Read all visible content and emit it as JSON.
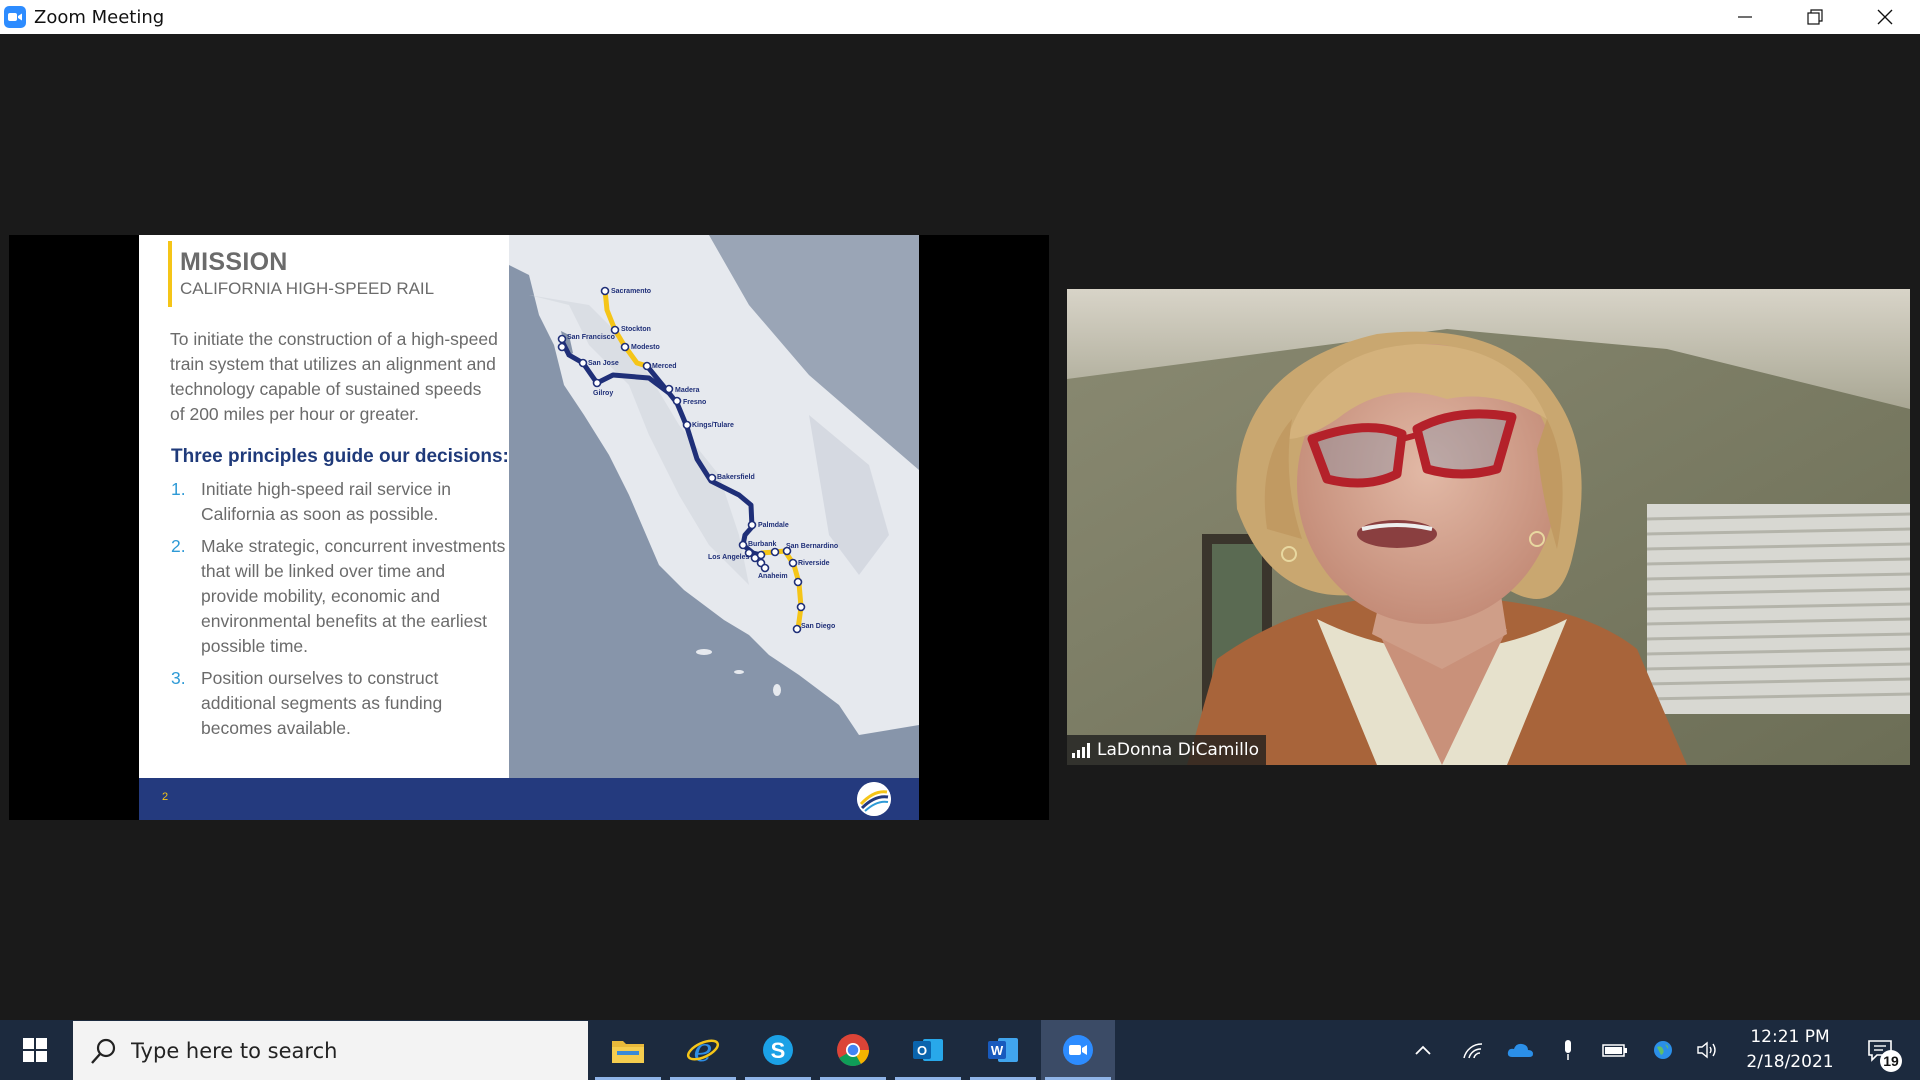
{
  "window": {
    "title": "Zoom Meeting"
  },
  "slide": {
    "title": "MISSION",
    "subtitle": "CALIFORNIA HIGH-SPEED RAIL",
    "description": "To initiate the construction of a high-speed train system that utilizes an alignment and technology capable of sustained speeds of 200 miles per hour or greater.",
    "principles_heading": "Three principles guide our decisions:",
    "principles": [
      {
        "num": "1.",
        "text": "Initiate high-speed rail service in California as soon as possible."
      },
      {
        "num": "2.",
        "text": "Make strategic, concurrent investments that will be linked over time and provide mobility, economic and environmental benefits at the earliest possible time."
      },
      {
        "num": "3.",
        "text": "Position ourselves to construct additional segments as funding becomes available."
      }
    ],
    "page_number": "2",
    "map_cities": {
      "sacramento": "Sacramento",
      "stockton": "Stockton",
      "modesto": "Modesto",
      "merced": "Merced",
      "san_francisco": "San Francisco",
      "san_jose": "San Jose",
      "gilroy": "Gilroy",
      "madera": "Madera",
      "fresno": "Fresno",
      "kings_tulare": "Kings/Tulare",
      "bakersfield": "Bakersfield",
      "palmdale": "Palmdale",
      "burbank": "Burbank",
      "los_angeles": "Los Angeles",
      "san_bernardino": "San Bernardino",
      "riverside": "Riverside",
      "anaheim": "Anaheim",
      "san_diego": "San Diego"
    },
    "colors": {
      "phase1": "#1f2f78",
      "phase2": "#f5c518",
      "footer": "#243a7e",
      "heading": "#1f3a7a",
      "number": "#2e9ad6"
    }
  },
  "participant": {
    "name": "LaDonna DiCamillo"
  },
  "taskbar": {
    "search_placeholder": "Type here to search",
    "apps": [
      {
        "name": "file-explorer-icon"
      },
      {
        "name": "internet-explorer-icon"
      },
      {
        "name": "skype-icon"
      },
      {
        "name": "chrome-icon"
      },
      {
        "name": "outlook-icon"
      },
      {
        "name": "word-icon"
      },
      {
        "name": "zoom-icon",
        "active": true
      }
    ],
    "time": "12:21 PM",
    "date": "2/18/2021",
    "notification_count": "19"
  }
}
